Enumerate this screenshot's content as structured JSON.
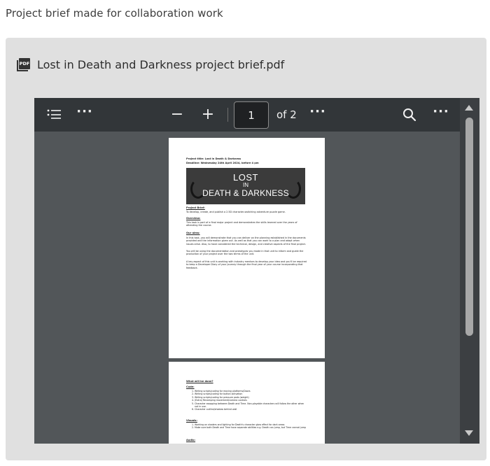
{
  "caption": "Project brief made for collaboration work",
  "file": {
    "name": "Lost in Death and Darkness project brief.pdf",
    "icon": "pdf-file-icon",
    "icon_text": "PDF"
  },
  "toolbar": {
    "outline_icon": "list-icon",
    "more_icon": "more-horizontal-icon",
    "zoom_out": "−",
    "zoom_in": "+",
    "current_page": "1",
    "page_total": "of 2",
    "search_icon": "search-icon"
  },
  "doc": {
    "page1": {
      "title_line": "Project title: Lost in Death & Darkness",
      "deadline": "Deadline: Wednesday 24th April 2024, before 4 pm",
      "banner": {
        "line1": "LOST",
        "line2": "IN",
        "line3": "DEATH & DARKNESS"
      },
      "h_brief": "Project Brief:",
      "brief": "To develop, create, and publish a 2.5D character-switching adventure puzzle game.",
      "h_overview": "Overview:",
      "overview": "This task is part of a final major project and demonstrates the skills learned over the years of attending the course.",
      "h_aim": "Our aims:",
      "aim1": "In this task, you will demonstrate that you can deliver on the planning established in the documents provided and the information given out. As well as that you can work to a plan and adapt when issues arise. Also, to have considered the technical, design, and creative aspects of the final project.",
      "aim2": "You will be using the documentation and prototypes you made in that unit to inform and guide the production of your project over the two terms of the unit.",
      "aim3": "A key aspect of this unit is working with industry mentors to develop your idea and you'll be required to keep a Developer Diary of your journey through the final year of your course incorporating that feedback."
    },
    "page2": {
      "heading": "What will be done?",
      "h_code": "Code:",
      "code_items": [
        "Writing scripts/coding for moving platforms/Doors",
        "Writing scripts/coding for button activation",
        "Writing scripts/coding for pressure pads (weight)",
        "(Extra) Revamping movement/camera controls",
        "Character swapping between Death and Time. Non-playable characters will follow the other when not in use.",
        "Character outline/shadow behind wall"
      ],
      "h_visuals": "Visuals:",
      "visual_items": [
        "Working on shaders and lighting for Death's character glow effect for dark areas",
        "Make sure both Death and Time have separate abilities e.g. Death can jump, but Time cannot jump"
      ],
      "h_audio": "Audio:"
    }
  },
  "colors": {
    "card_bg": "#e0e0e0",
    "toolbar_bg": "#323639",
    "viewer_bg": "#525659"
  }
}
